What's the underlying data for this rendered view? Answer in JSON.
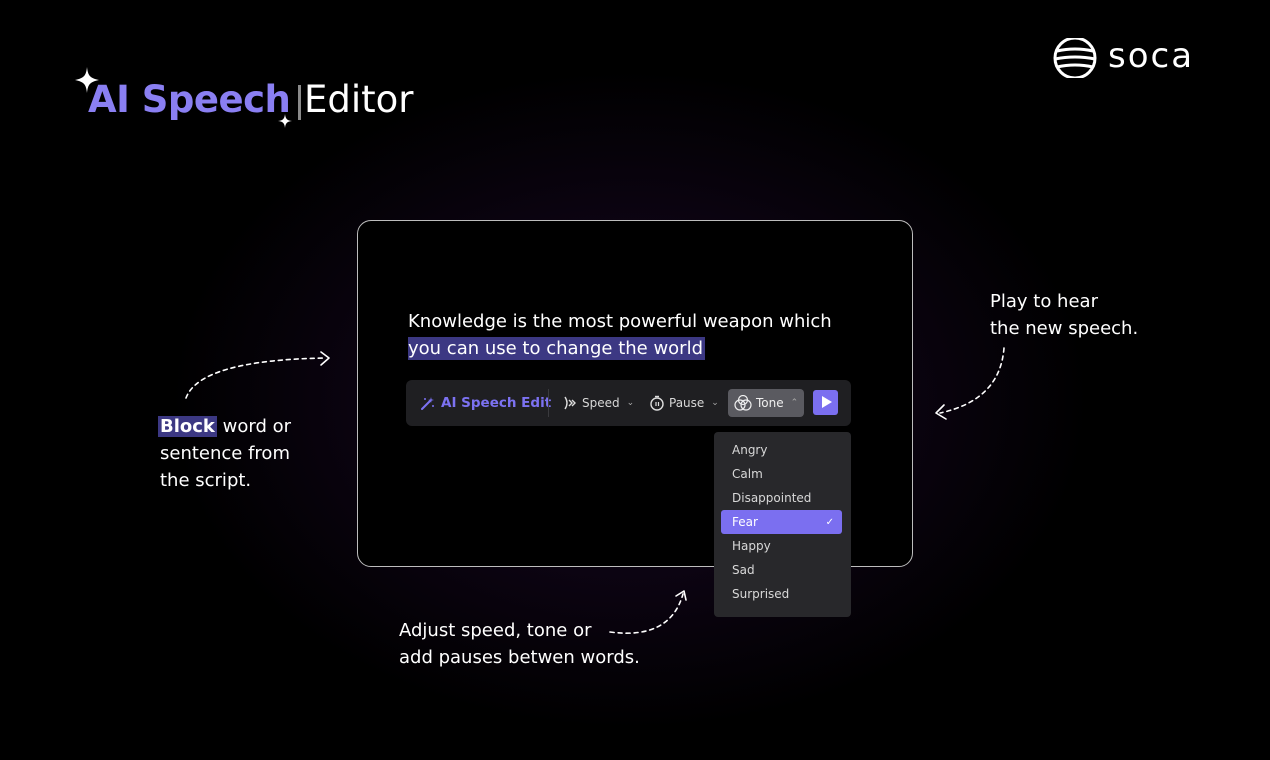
{
  "header": {
    "title_ai": "AI Speech",
    "title_editor": "Editor",
    "logo_text": "soca"
  },
  "editor": {
    "sentence_line1": "Knowledge is the most powerful weapon which",
    "sentence_line2": "you can use to change the world"
  },
  "toolbar": {
    "ai_label": "AI Speech Edit",
    "speed_label": "Speed",
    "pause_label": "Pause",
    "tone_label": "Tone"
  },
  "tone_menu": {
    "options": [
      "Angry",
      "Calm",
      "Disappointed",
      "Fear",
      "Happy",
      "Sad",
      "Surprised"
    ],
    "selected": "Fear"
  },
  "annotations": {
    "block_highlight": "Block",
    "block_rest_line1": " word or",
    "block_line2": "sentence from",
    "block_line3": "the script.",
    "play_line1": "Play to hear",
    "play_line2": "the new speech.",
    "adjust_line1": "Adjust speed, tone or",
    "adjust_line2": "add pauses betwen words."
  },
  "colors": {
    "accent": "#7b6ff0",
    "highlight": "#3c3883",
    "title_purple": "#8a7ff2"
  }
}
